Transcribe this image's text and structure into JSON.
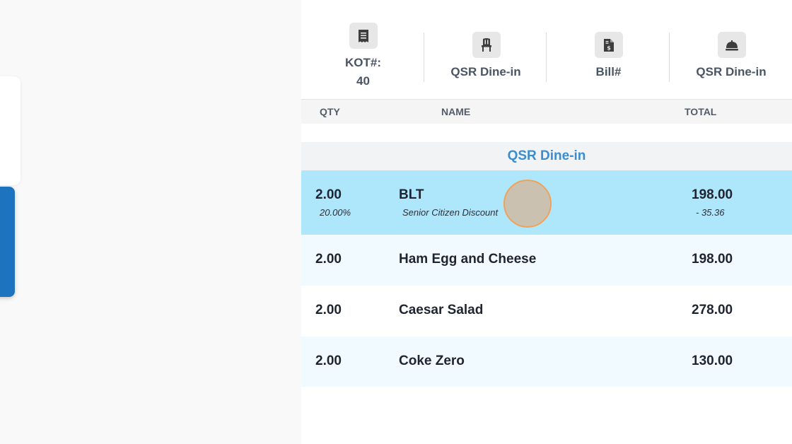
{
  "info_bar": {
    "kot_label": "KOT#:",
    "kot_number": "40",
    "table_type": "QSR Dine-in",
    "bill_label": "Bill#",
    "service_type": "QSR Dine-in"
  },
  "table_header": {
    "qty": "QTY",
    "name": "NAME",
    "total": "TOTAL"
  },
  "group": {
    "label": "QSR Dine-in"
  },
  "items": [
    {
      "qty": "2.00",
      "name": "BLT",
      "total": "198.00",
      "discount_rate": "20.00%",
      "discount_name": "Senior Citizen Discount",
      "discount_amount": "- 35.36",
      "selected": true
    },
    {
      "qty": "2.00",
      "name": "Ham Egg and Cheese",
      "total": "198.00"
    },
    {
      "qty": "2.00",
      "name": "Caesar Salad",
      "total": "278.00"
    },
    {
      "qty": "2.00",
      "name": "Coke Zero",
      "total": "130.00"
    }
  ],
  "colors": {
    "selected_row": "#aee6fb",
    "alt_row": "#f0faff",
    "accent_blue": "#3b8dd0",
    "button_blue": "#1e73be"
  },
  "icons": {
    "kot": "receipt-icon",
    "table": "chair-icon",
    "bill": "bill-document-icon",
    "service": "service-bell-icon"
  }
}
